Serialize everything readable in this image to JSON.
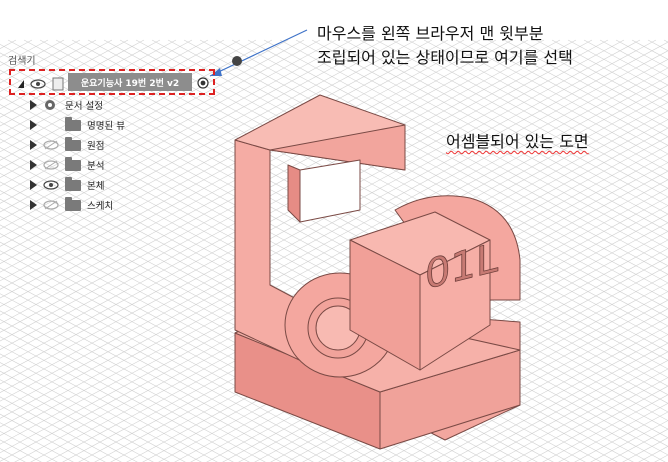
{
  "browser": {
    "title": "검색기",
    "root_label": "운요기능사 19번 2번 v2",
    "items": [
      {
        "label": "문서 설정",
        "icon": "gear-icon"
      },
      {
        "label": "명명된 뷰",
        "icon": "folder-icon"
      },
      {
        "label": "원점",
        "icon": "folder-icon"
      },
      {
        "label": "분석",
        "icon": "folder-icon"
      },
      {
        "label": "본체",
        "icon": "folder-icon"
      },
      {
        "label": "스케치",
        "icon": "folder-icon"
      }
    ]
  },
  "annotations": {
    "line1": "마우스를 왼쪽 브라우저 맨 윗부분",
    "line2": "조립되어 있는 상태이므로 여기를 선택",
    "line3": "어셈블되어 있는 도면"
  },
  "model": {
    "engraving": "01L",
    "color": "#f4a79f"
  },
  "colors": {
    "highlight": "#dd2222",
    "arrow": "#3f73c8",
    "grid": "#cfcfcf"
  }
}
